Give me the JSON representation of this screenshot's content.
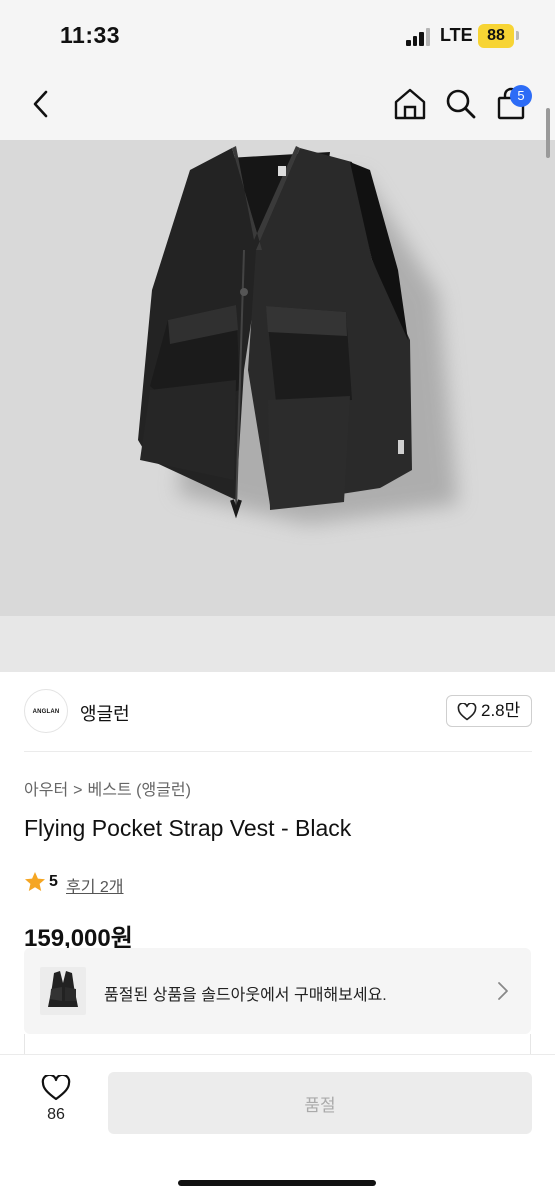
{
  "status_bar": {
    "time": "11:33",
    "network": "LTE",
    "battery": "88"
  },
  "nav": {
    "back_icon": "chevron-left-icon",
    "home_icon": "home-icon",
    "search_icon": "search-icon",
    "cart_icon": "shopping-bag-icon",
    "cart_count": "5"
  },
  "product_image": {
    "subject": "black utility vest with chest pockets"
  },
  "brand": {
    "logo_text": "ANGLAN",
    "name": "앵글런",
    "likes": "2.8만"
  },
  "breadcrumb": {
    "items": [
      "아우터",
      "베스트 (앵글런)"
    ],
    "separator": ">"
  },
  "product": {
    "title": "Flying Pocket Strap Vest - Black",
    "rating": "5",
    "reviews": "후기 2개",
    "price": "159,000원"
  },
  "soldout_banner": {
    "text": "품절된 상품을 솔드아웃에서 구매해보세요."
  },
  "bottom_bar": {
    "wish_count": "86",
    "buy_label": "품절"
  },
  "colors": {
    "accent_blue": "#2d6cf6",
    "star": "#f5a623",
    "battery": "#f7d434",
    "hero_bg": "#d9d9d9"
  }
}
